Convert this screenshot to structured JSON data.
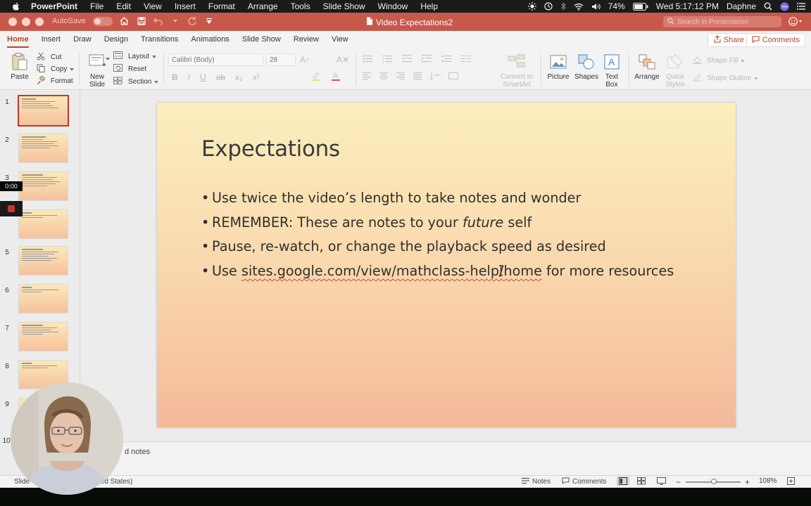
{
  "menubar": {
    "app_name": "PowerPoint",
    "items": [
      "File",
      "Edit",
      "View",
      "Insert",
      "Format",
      "Arrange",
      "Tools",
      "Slide Show",
      "Window",
      "Help"
    ],
    "battery": "74%",
    "clock": "Wed 5:17:12 PM",
    "user": "Daphne"
  },
  "titlebar": {
    "autosave_label": "AutoSave",
    "autosave_state": "OFF",
    "doc_title": "Video Expectations2",
    "search_placeholder": "Search in Presentation"
  },
  "ribbon": {
    "tabs": [
      "Home",
      "Insert",
      "Draw",
      "Design",
      "Transitions",
      "Animations",
      "Slide Show",
      "Review",
      "View"
    ],
    "active_tab": "Home",
    "share_label": "Share",
    "comments_label": "Comments",
    "clipboard": {
      "paste": "Paste",
      "cut": "Cut",
      "copy": "Copy",
      "format": "Format"
    },
    "slides": {
      "new_slide_line1": "New",
      "new_slide_line2": "Slide",
      "layout": "Layout",
      "reset": "Reset",
      "section": "Section"
    },
    "font": {
      "name_placeholder": "Calibri (Body)",
      "size_placeholder": "28"
    },
    "convert": {
      "line1": "Convert to",
      "line2": "SmartArt"
    },
    "insert": {
      "picture": "Picture",
      "shapes": "Shapes",
      "textbox_line1": "Text",
      "textbox_line2": "Box"
    },
    "arrange": {
      "arrange": "Arrange",
      "quick_styles_line1": "Quick",
      "quick_styles_line2": "Styles",
      "shape_fill": "Shape Fill",
      "shape_outline": "Shape Outline"
    }
  },
  "thumbnails": {
    "numbers": [
      "1",
      "2",
      "3",
      "5",
      "6",
      "7",
      "8",
      "9",
      "10"
    ],
    "selected": "1"
  },
  "recorder": {
    "time": "0:00"
  },
  "slide": {
    "title": "Expectations",
    "bullet1": "Use twice the video’s length to take notes and wonder",
    "bullet2_pre": "REMEMBER: These are notes to your ",
    "bullet2_em": "future",
    "bullet2_post": " self",
    "bullet3": "Pause, re-watch, or change the playback speed as desired",
    "bullet4_pre": "Use ",
    "bullet4_link": "sites.google.com/view/mathclass-help/home",
    "bullet4_post": " for more resources"
  },
  "notes": {
    "placeholder": "d notes"
  },
  "statusbar": {
    "slide_label": "Slide",
    "language": "ted States)",
    "notes_btn": "Notes",
    "comments_btn": "Comments",
    "zoom": "108%"
  },
  "colors": {
    "titlebar": "#c7584a",
    "accent": "#b7472a",
    "slide_top": "#fcefbd",
    "slide_bottom": "#f4b99a"
  }
}
